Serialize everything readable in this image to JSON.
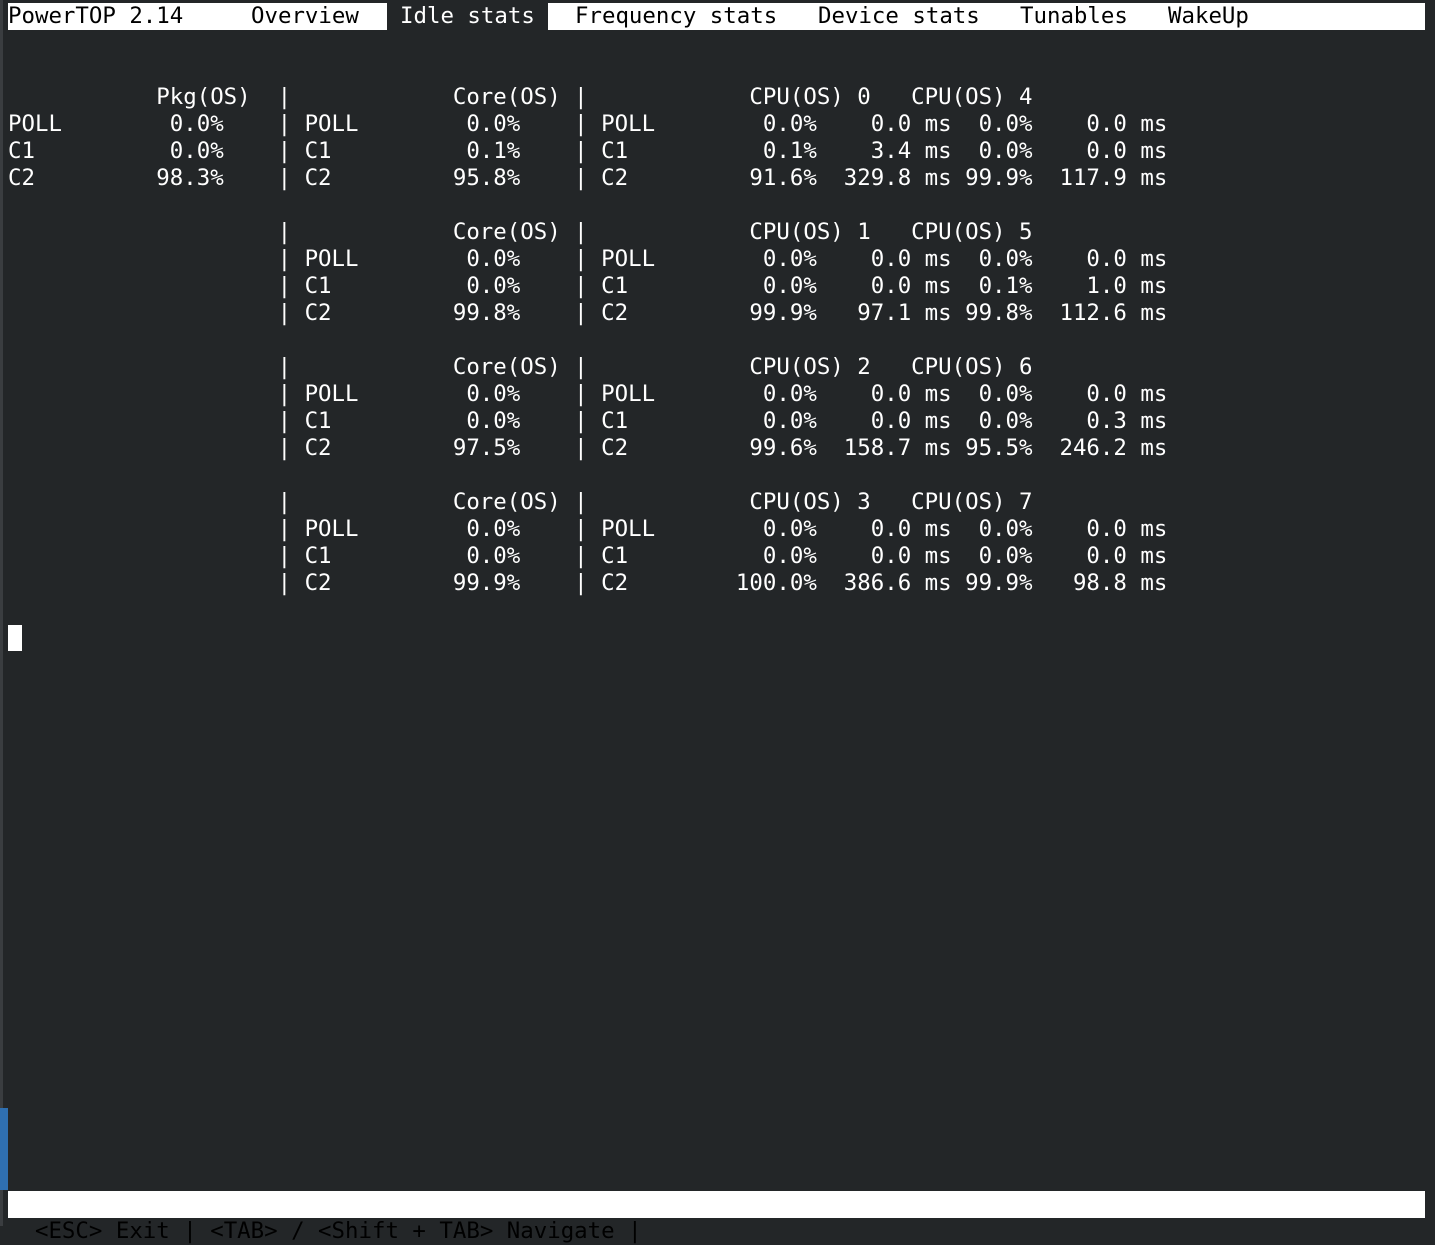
{
  "header": {
    "app_title": "PowerTOP 2.14",
    "tabs": [
      {
        "label": "Overview",
        "active": false
      },
      {
        "label": "Idle stats",
        "active": true
      },
      {
        "label": "Frequency stats",
        "active": false
      },
      {
        "label": "Device stats",
        "active": false
      },
      {
        "label": "Tunables",
        "active": false
      },
      {
        "label": "WakeUp",
        "active": false
      }
    ]
  },
  "idle_stats": {
    "lines": [
      "           Pkg(OS)  |            Core(OS) |            CPU(OS) 0   CPU(OS) 4",
      "POLL        0.0%    | POLL        0.0%    | POLL        0.0%    0.0 ms  0.0%    0.0 ms",
      "C1          0.0%    | C1          0.1%    | C1          0.1%    3.4 ms  0.0%    0.0 ms",
      "C2         98.3%    | C2         95.8%    | C2         91.6%  329.8 ms 99.9%  117.9 ms",
      "",
      "                    |            Core(OS) |            CPU(OS) 1   CPU(OS) 5",
      "                    | POLL        0.0%    | POLL        0.0%    0.0 ms  0.0%    0.0 ms",
      "                    | C1          0.0%    | C1          0.0%    0.0 ms  0.1%    1.0 ms",
      "                    | C2         99.8%    | C2         99.9%   97.1 ms 99.8%  112.6 ms",
      "",
      "                    |            Core(OS) |            CPU(OS) 2   CPU(OS) 6",
      "                    | POLL        0.0%    | POLL        0.0%    0.0 ms  0.0%    0.0 ms",
      "                    | C1          0.0%    | C1          0.0%    0.0 ms  0.0%    0.3 ms",
      "                    | C2         97.5%    | C2         99.6%  158.7 ms 95.5%  246.2 ms",
      "",
      "                    |            Core(OS) |            CPU(OS) 3   CPU(OS) 7",
      "                    | POLL        0.0%    | POLL        0.0%    0.0 ms  0.0%    0.0 ms",
      "                    | C1          0.0%    | C1          0.0%    0.0 ms  0.0%    0.0 ms",
      "                    | C2         99.9%    | C2        100.0%  386.6 ms 99.9%   98.8 ms"
    ]
  },
  "footer": {
    "hint": "<ESC> Exit | <TAB> / <Shift + TAB> Navigate |"
  },
  "colors": {
    "background": "#232628",
    "bar_background": "#ffffff",
    "text": "#ffffff",
    "accent": "#2f6fb0"
  }
}
